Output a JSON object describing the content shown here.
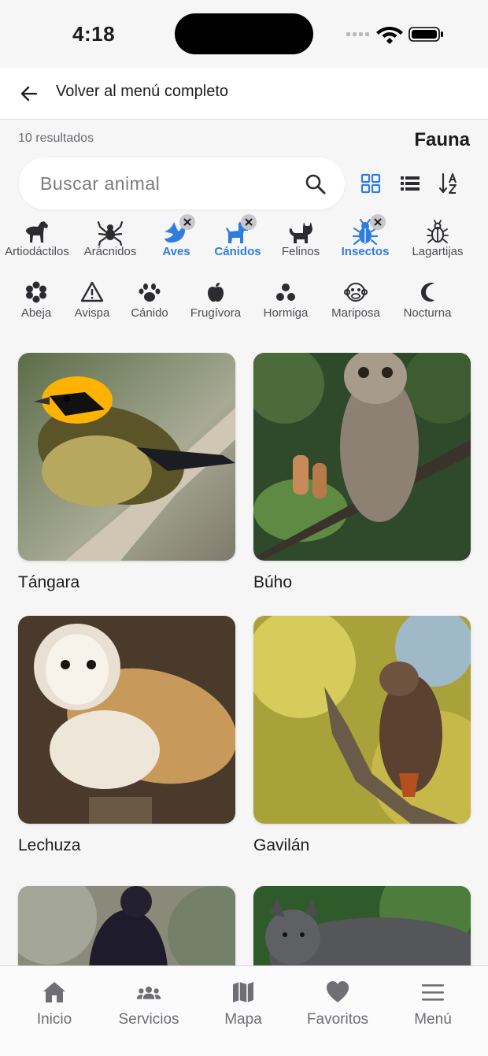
{
  "status_bar": {
    "time": "4:18"
  },
  "header": {
    "back_label": "Volver al menú completo"
  },
  "results": {
    "count_label": "10 resultados",
    "section_title": "Fauna"
  },
  "search": {
    "placeholder": "Buscar animal"
  },
  "view_controls": [
    "grid-view-icon",
    "list-view-icon",
    "sort-alpha-icon"
  ],
  "filters_primary": [
    {
      "label": "Artiodáctilos",
      "icon": "horse-icon",
      "active": false
    },
    {
      "label": "Arácnidos",
      "icon": "spider-icon",
      "active": false
    },
    {
      "label": "Aves",
      "icon": "bird-icon",
      "active": true
    },
    {
      "label": "Cánidos",
      "icon": "dog-icon",
      "active": true
    },
    {
      "label": "Felinos",
      "icon": "cat-icon",
      "active": false
    },
    {
      "label": "Insectos",
      "icon": "bug-icon",
      "active": true
    },
    {
      "label": "Lagartijas",
      "icon": "beetle-icon",
      "active": false
    }
  ],
  "filters_secondary": [
    {
      "label": "Abeja",
      "icon": "flower-icon"
    },
    {
      "label": "Avispa",
      "icon": "warning-icon"
    },
    {
      "label": "Cánido",
      "icon": "paw-icon"
    },
    {
      "label": "Frugívora",
      "icon": "apple-icon"
    },
    {
      "label": "Hormiga",
      "icon": "dots-icon"
    },
    {
      "label": "Mariposa",
      "icon": "monkey-icon"
    },
    {
      "label": "Nocturna",
      "icon": "moon-icon"
    }
  ],
  "animals": [
    {
      "name": "Tángara"
    },
    {
      "name": "Búho"
    },
    {
      "name": "Lechuza"
    },
    {
      "name": "Gavilán"
    },
    {
      "name": ""
    },
    {
      "name": ""
    }
  ],
  "tabs": [
    {
      "label": "Inicio",
      "icon": "home-icon"
    },
    {
      "label": "Servicios",
      "icon": "people-icon"
    },
    {
      "label": "Mapa",
      "icon": "map-icon"
    },
    {
      "label": "Favoritos",
      "icon": "heart-icon"
    },
    {
      "label": "Menú",
      "icon": "menu-icon"
    }
  ],
  "colors": {
    "accent": "#2f7de1",
    "text": "#1d1d1f",
    "muted": "#6e6e73",
    "background": "#f6f6f7"
  }
}
